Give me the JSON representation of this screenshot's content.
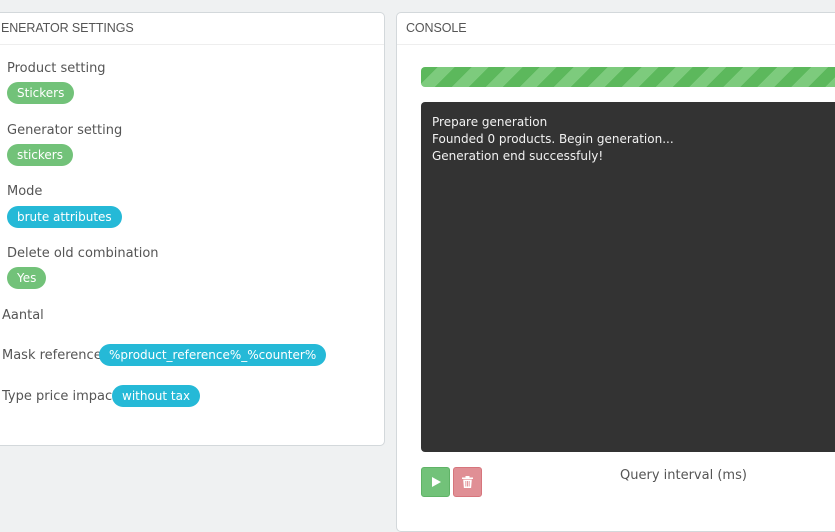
{
  "settings_panel": {
    "title": "ENERATOR SETTINGS",
    "product_setting": {
      "label": "Product setting",
      "value": "Stickers"
    },
    "generator_setting": {
      "label": "Generator setting",
      "value": "stickers"
    },
    "mode": {
      "label": "Mode",
      "value": "brute attributes"
    },
    "delete_old": {
      "label": "Delete old combination",
      "value": "Yes"
    },
    "aantal": {
      "label": "Aantal"
    },
    "mask_reference": {
      "label": "Mask reference",
      "value": "%product_reference%_%counter%"
    },
    "type_price_impact": {
      "label": "Type price impact",
      "value": "without tax"
    }
  },
  "console_panel": {
    "title": "CONSOLE",
    "progress_percent": 100,
    "lines": [
      "Prepare generation",
      "Founded 0 products. Begin generation...",
      "Generation end successfuly!"
    ],
    "query_interval_label": "Query interval (ms)"
  },
  "colors": {
    "green_badge": "#72c279",
    "blue_badge": "#25b9d7",
    "console_bg": "#333333",
    "delete_button": "#e08f95"
  },
  "icons": [
    "play-icon",
    "trash-icon"
  ]
}
